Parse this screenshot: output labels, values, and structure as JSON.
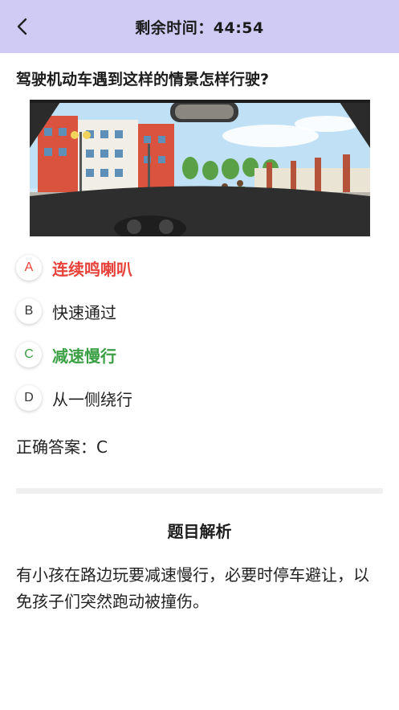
{
  "header": {
    "timer_label": "剩余时间：44:54",
    "back_icon": "chevron-left-icon",
    "background": "#cfcbf5"
  },
  "question": {
    "text": "驾驶机动车遇到这样的情景怎样行驶?"
  },
  "options": [
    {
      "letter": "A",
      "text": "连续鸣喇叭",
      "state": "wrong"
    },
    {
      "letter": "B",
      "text": "快速通过",
      "state": "normal"
    },
    {
      "letter": "C",
      "text": "减速慢行",
      "state": "correct"
    },
    {
      "letter": "D",
      "text": "从一侧绕行",
      "state": "normal"
    }
  ],
  "answer": {
    "text": "正确答案：C"
  },
  "analysis": {
    "title": "题目解析",
    "text": "有小孩在路边玩要减速慢行，必要时停车避让，以免孩子们突然跑动被撞伤。"
  },
  "colors": {
    "wrong": "#e8413a",
    "correct": "#3aa043"
  }
}
